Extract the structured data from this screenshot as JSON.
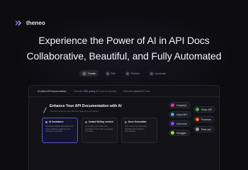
{
  "brand": {
    "name": "theneo",
    "accent": "#8d86ff"
  },
  "hero": {
    "line1": "Experience the Power of AI in API Docs",
    "line2": "Collaborative, Beautiful, and Fully Automated"
  },
  "steps": [
    {
      "num": "1",
      "label": "Create",
      "active": true
    },
    {
      "num": "2",
      "label": "Edit",
      "active": false
    },
    {
      "num": "3",
      "label": "Publish",
      "active": false
    },
    {
      "num": "4",
      "label": "Automate",
      "active": false
    }
  ],
  "panel": {
    "tabs": [
      {
        "pre": "",
        "hl": "",
        "post": "AI-driven API documentation"
      },
      {
        "pre": "Generate ",
        "hl": "SDK-quality",
        "post": " API docs in seconds"
      },
      {
        "pre": "Eliminate ",
        "hl": "manual",
        "post": " API docs"
      }
    ],
    "feature_title": "Enhance Your API Documentation with AI",
    "feature_subtitle": "Theneo's AI turns your API into clear documentation",
    "cards": [
      {
        "title": "AI Assistance",
        "text": "Generate polished descriptions for every endpoint, parameter and response in one click.",
        "selected": true
      },
      {
        "title": "Instant Writing content",
        "text": "Let AI write summaries and examples so your docs are always up to date.",
        "selected": false
      },
      {
        "title": "Docs Generation",
        "text": "Turn a spec into interactive, beautiful documentation automatically.",
        "selected": false
      }
    ],
    "integrations_left": [
      {
        "label": "GraphQL",
        "icon": "graphql-icon",
        "color": "#e535ab"
      },
      {
        "label": "AsyncAPI",
        "icon": "asyncapi-icon",
        "color": "#3da6ff"
      },
      {
        "label": "Insomnia",
        "icon": "insomnia-icon",
        "color": "#7a4cf0"
      },
      {
        "label": "Swagger",
        "icon": "swagger-icon",
        "color": "#85ea2d"
      }
    ],
    "integrations_right": [
      {
        "label": "Soap-API",
        "icon": "soap-icon",
        "color": "#4caf50"
      },
      {
        "label": "Postman",
        "icon": "postman-icon",
        "color": "#ff6c37"
      },
      {
        "label": "Rest-Api",
        "icon": "rest-icon",
        "color": "#9e9eaa"
      }
    ]
  }
}
